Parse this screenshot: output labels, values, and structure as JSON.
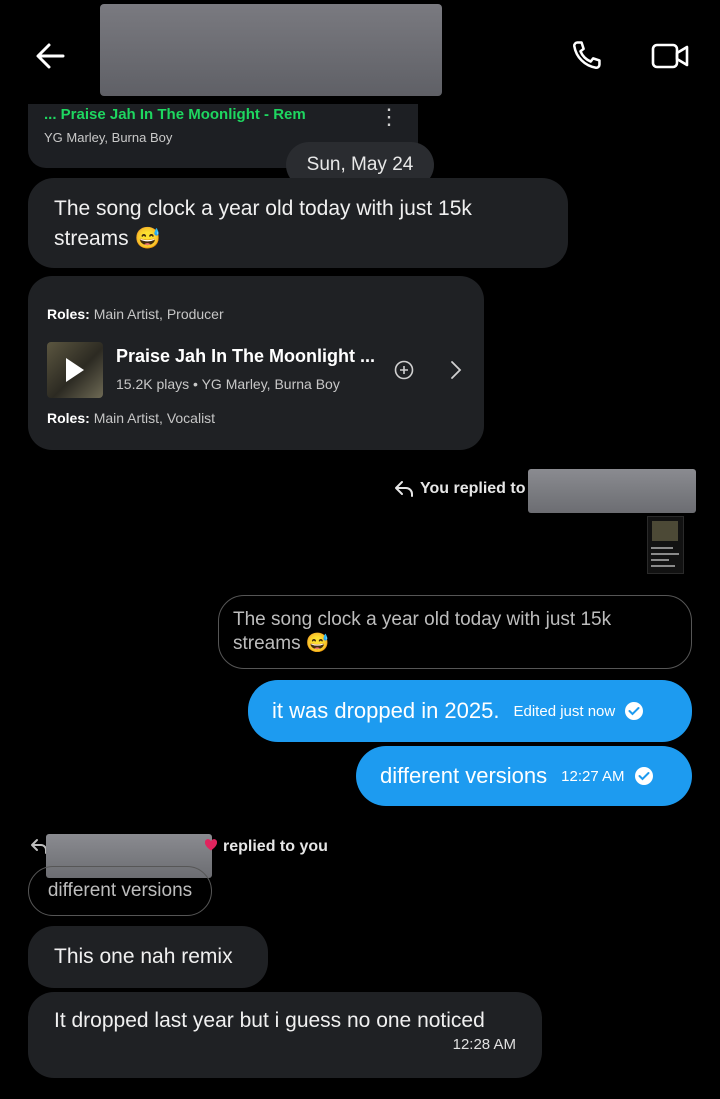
{
  "header": {
    "back_icon": "arrow-left-icon",
    "call_icon": "phone-icon",
    "video_icon": "video-camera-icon"
  },
  "top_card": {
    "song": "... Praise Jah In The Moonlight - Rem",
    "artists": "YG Marley, Burna Boy",
    "more_icon": "kebab-icon"
  },
  "date_divider": "Sun, May 24",
  "messages": {
    "m1": "The song clock a year old today with just 15k streams 😅",
    "share_card": {
      "roles_top_label": "Roles:",
      "roles_top_value": "Main Artist, Producer",
      "track_title": "Praise Jah In The Moonlight ...",
      "track_meta": "15.2K plays • YG Marley, Burna Boy",
      "roles_bottom_label": "Roles:",
      "roles_bottom_value": "Main Artist, Vocalist"
    },
    "reply_label": "You replied to",
    "quoted_out": "The song clock a year old today with just 15k streams 😅",
    "out1": {
      "text": "it was dropped in 2025.",
      "meta": "Edited just now"
    },
    "out2": {
      "text": "different versions",
      "meta": "12:27 AM"
    },
    "reply_in_label": "replied to you",
    "quoted_in": "different versions",
    "in2": "This one nah remix",
    "in3": {
      "text": "It dropped last year but i guess no one noticed",
      "time": "12:28 AM"
    }
  },
  "colors": {
    "background": "#000000",
    "incoming_bubble": "#1f2124",
    "outgoing_bubble": "#1d9bf0",
    "spotify_green": "#1ed760"
  }
}
